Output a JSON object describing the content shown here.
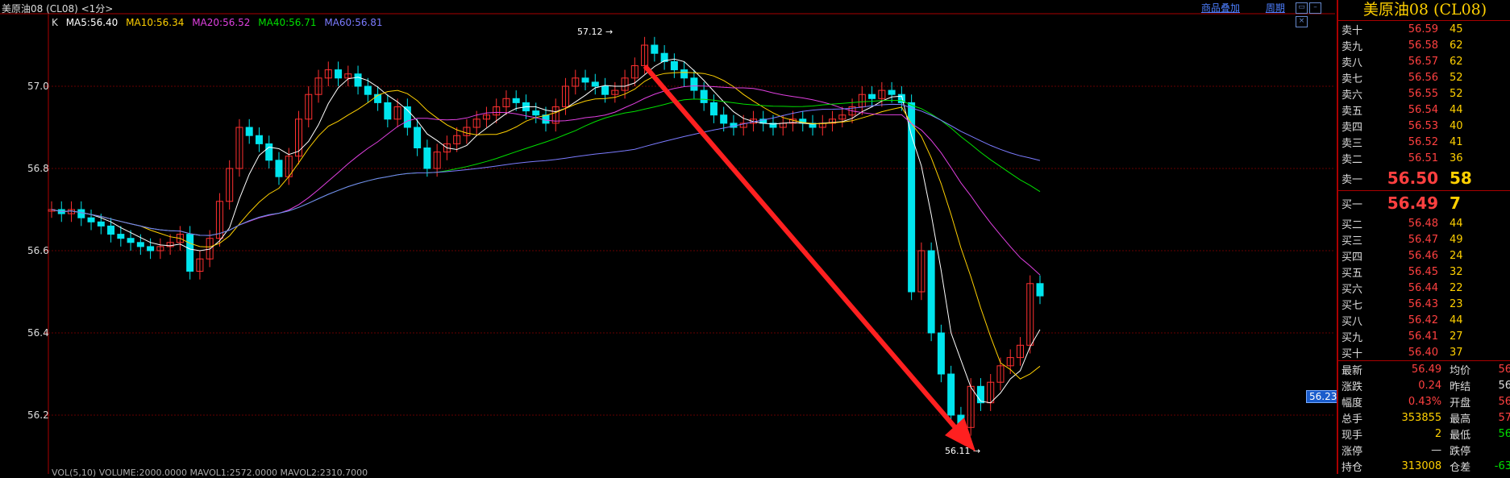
{
  "header": {
    "instrument_title": "美原油08 (CL08) <1分>",
    "k_label": "K",
    "ma": [
      {
        "label": "MA5:56.40",
        "color": "#ffffff"
      },
      {
        "label": "MA10:56.34",
        "color": "#ffd000"
      },
      {
        "label": "MA20:56.52",
        "color": "#e040e0"
      },
      {
        "label": "MA40:56.71",
        "color": "#00e000"
      },
      {
        "label": "MA60:56.81",
        "color": "#7b7bff"
      }
    ],
    "link_overlay": "商品叠加",
    "link_period": "周期"
  },
  "chart": {
    "y_ticks": [
      "57.0",
      "56.8",
      "56.6",
      "56.4",
      "56.2"
    ],
    "high_label": "57.12",
    "low_label": "56.11",
    "current_price_tag": "56.23",
    "volume_line": "VOL(5,10) VOLUME:2000.0000 MAVOL1:2572.0000 MAVOL2:2310.7000",
    "colors": {
      "up": "#ff3030",
      "down": "#00e5ee",
      "arrow": "#ff2020"
    }
  },
  "panel": {
    "title": "美原油08 (CL08)",
    "asks": [
      {
        "label": "卖十",
        "price": "56.59",
        "vol": "45"
      },
      {
        "label": "卖九",
        "price": "56.58",
        "vol": "62"
      },
      {
        "label": "卖八",
        "price": "56.57",
        "vol": "62"
      },
      {
        "label": "卖七",
        "price": "56.56",
        "vol": "52"
      },
      {
        "label": "卖六",
        "price": "56.55",
        "vol": "52"
      },
      {
        "label": "卖五",
        "price": "56.54",
        "vol": "44"
      },
      {
        "label": "卖四",
        "price": "56.53",
        "vol": "40"
      },
      {
        "label": "卖三",
        "price": "56.52",
        "vol": "41"
      },
      {
        "label": "卖二",
        "price": "56.51",
        "vol": "36"
      }
    ],
    "ask1": {
      "label": "卖一",
      "price": "56.50",
      "vol": "58"
    },
    "bid1": {
      "label": "买一",
      "price": "56.49",
      "vol": "7"
    },
    "bids": [
      {
        "label": "买二",
        "price": "56.48",
        "vol": "44"
      },
      {
        "label": "买三",
        "price": "56.47",
        "vol": "49"
      },
      {
        "label": "买四",
        "price": "56.46",
        "vol": "24"
      },
      {
        "label": "买五",
        "price": "56.45",
        "vol": "32"
      },
      {
        "label": "买六",
        "price": "56.44",
        "vol": "22"
      },
      {
        "label": "买七",
        "price": "56.43",
        "vol": "23"
      },
      {
        "label": "买八",
        "price": "56.42",
        "vol": "44"
      },
      {
        "label": "买九",
        "price": "56.41",
        "vol": "27"
      },
      {
        "label": "买十",
        "price": "56.40",
        "vol": "37"
      }
    ],
    "stats": [
      {
        "l1": "最新",
        "v1": "56.49",
        "c1": "red",
        "l2": "均价",
        "v2": "56",
        "c2": "red"
      },
      {
        "l1": "涨跌",
        "v1": "0.24",
        "c1": "red",
        "l2": "昨结",
        "v2": "56",
        "c2": "white"
      },
      {
        "l1": "幅度",
        "v1": "0.43%",
        "c1": "red",
        "l2": "开盘",
        "v2": "56",
        "c2": "red"
      },
      {
        "l1": "总手",
        "v1": "353855",
        "c1": "yellow",
        "l2": "最高",
        "v2": "57",
        "c2": "red"
      },
      {
        "l1": "现手",
        "v1": "2",
        "c1": "yellow",
        "l2": "最低",
        "v2": "56",
        "c2": "green"
      },
      {
        "l1": "涨停",
        "v1": "—",
        "c1": "white",
        "l2": "跌停",
        "v2": "",
        "c2": "white"
      },
      {
        "l1": "持仓",
        "v1": "313008",
        "c1": "yellow",
        "l2": "仓差",
        "v2": "-63",
        "c2": "green"
      }
    ]
  }
}
